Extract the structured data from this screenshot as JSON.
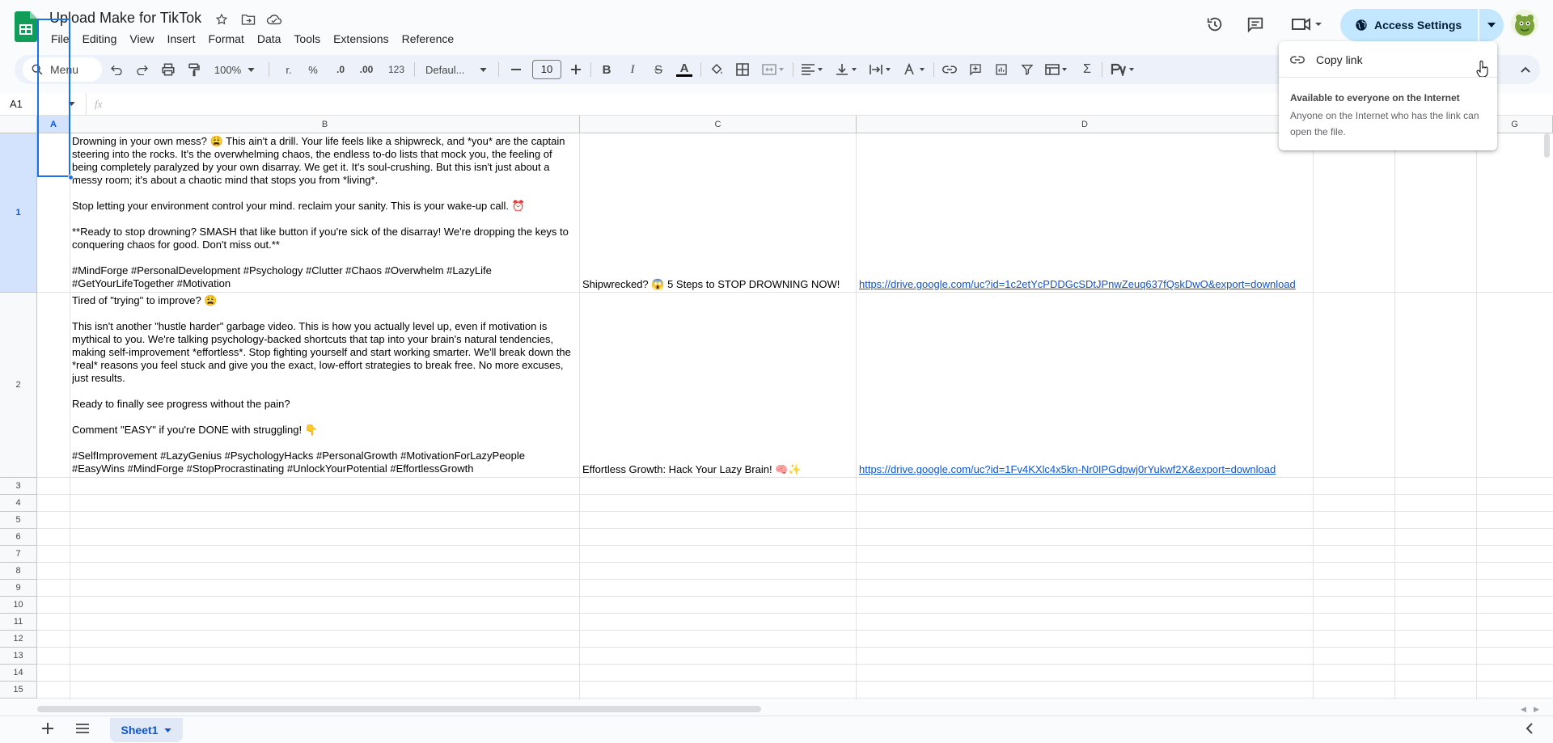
{
  "app": {
    "title": "Upload Make for TikTok",
    "brand_color": "#0f9d58",
    "accent": "#0b57d0"
  },
  "menu": [
    "File",
    "Editing",
    "View",
    "Insert",
    "Format",
    "Data",
    "Tools",
    "Extensions",
    "Reference"
  ],
  "header": {
    "access_label": "Access Settings",
    "access_color": "#c2e7ff"
  },
  "toolbar": {
    "search_label": "Menu",
    "zoom": "100%",
    "currency": "r.",
    "percent": "%",
    "dec_decrease": ".0",
    "dec_increase": ".00",
    "number_format": "123",
    "font": "Defaul...",
    "font_size": "10",
    "bold": "B",
    "italic": "I",
    "strike": "S",
    "text_color": "A",
    "sum": "Σ"
  },
  "formula_bar": {
    "name_box": "A1",
    "fx": "fx",
    "value": ""
  },
  "columns": [
    "A",
    "B",
    "C",
    "D",
    "",
    "",
    "G"
  ],
  "rows": [
    "1",
    "2",
    "3",
    "4",
    "5",
    "6",
    "7",
    "8",
    "9",
    "10",
    "11",
    "12",
    "13",
    "14",
    "15"
  ],
  "cells": {
    "b1": "Drowning in your own mess? 😩 This ain't a drill. Your life feels like a shipwreck, and *you* are the captain steering into the rocks. It's the overwhelming chaos, the endless to-do lists that mock you, the feeling of being completely paralyzed by your own disarray. We get it. It's soul-crushing. But this isn't just about a messy room; it's about a chaotic mind that stops you from *living*.\n\nStop letting your environment control your mind. reclaim your sanity. This is your wake-up call. ⏰\n\n**Ready to stop drowning? SMASH that like button if you're sick of the disarray! We're dropping the keys to conquering chaos for good. Don't miss out.**\n\n#MindForge #PersonalDevelopment #Psychology #Clutter #Chaos #Overwhelm #LazyLife #GetYourLifeTogether #Motivation",
    "c1": "Shipwrecked? 😱 5 Steps to STOP DROWNING NOW!",
    "d1": "https://drive.google.com/uc?id=1c2etYcPDDGcSDtJPnwZeuq637fQskDwO&export=download",
    "b2": "Tired of \"trying\" to improve? 😩\n\nThis isn't another \"hustle harder\" garbage video. This is how you actually level up, even if motivation is mythical to you. We're talking psychology-backed shortcuts that tap into your brain's natural tendencies, making self-improvement *effortless*. Stop fighting yourself and start working smarter. We'll break down the *real* reasons you feel stuck and give you the exact, low-effort strategies to break free. No more excuses, just results.\n\nReady to finally see progress without the pain?\n\nComment \"EASY\" if you're DONE with struggling! 👇\n\n#SelfImprovement #LazyGenius #PsychologyHacks #PersonalGrowth #MotivationForLazyPeople #EasyWins #MindForge #StopProcrastinating #UnlockYourPotential #EffortlessGrowth",
    "c2": "Effortless Growth: Hack Your Lazy Brain! 🧠✨",
    "d2": "https://drive.google.com/uc?id=1Fv4KXlc4x5kn-Nr0IPGdpwj0rYukwf2X&export=download"
  },
  "popup": {
    "copy_link": "Copy link",
    "title": "Available to everyone on the Internet",
    "description": "Anyone on the Internet who has the link can open the file."
  },
  "sheets": {
    "active": "Sheet1"
  }
}
